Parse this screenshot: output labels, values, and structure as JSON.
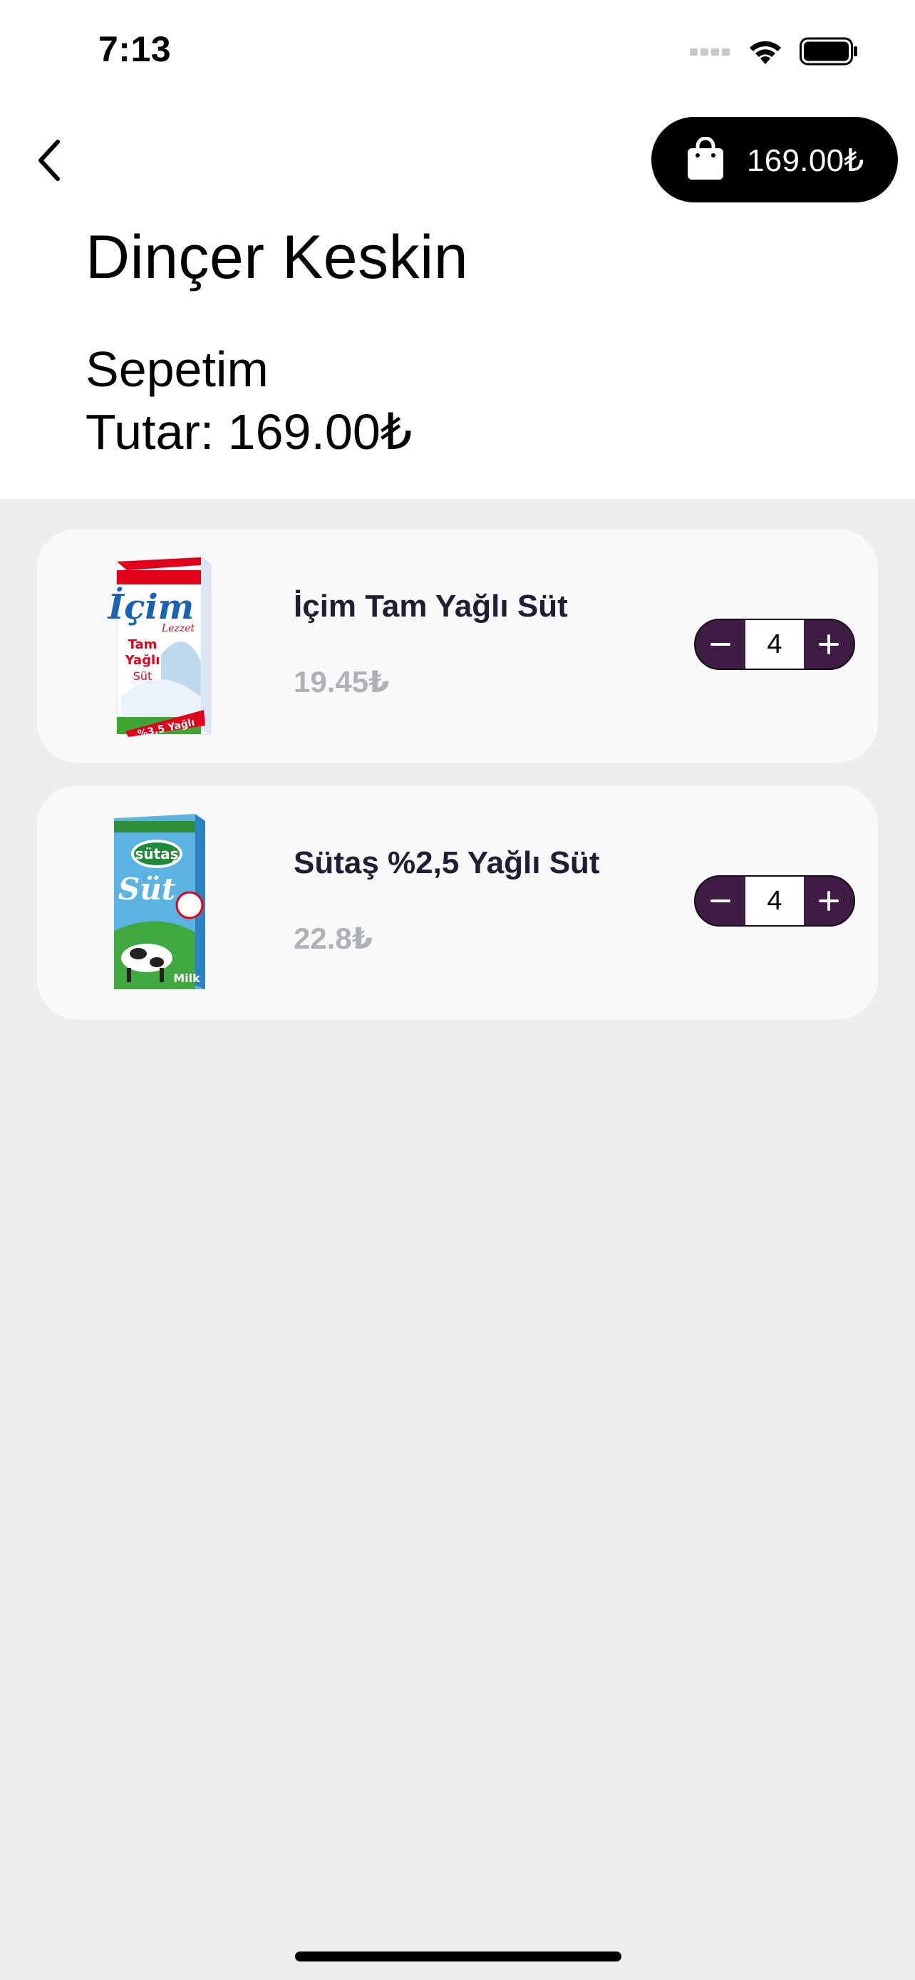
{
  "status_bar": {
    "time": "7:13",
    "icons": [
      "signal-icon",
      "wifi-icon",
      "battery-icon"
    ]
  },
  "header": {
    "back_icon": "chevron-left-icon",
    "cart_total": "169.00₺",
    "cart_icon": "shopping-bag-icon",
    "title": "Dinçer Keskin",
    "section": "Sepetim",
    "total_line": "Tutar: 169.00₺"
  },
  "cart": {
    "items": [
      {
        "name": "İçim Tam Yağlı Süt",
        "price": "19.45₺",
        "quantity": "4",
        "image_icon": "icim-milk-carton-image",
        "carton_labels": [
          "İçim",
          "Lezzet",
          "Tam",
          "Yağlı",
          "Süt",
          "%3,5 Yağlı"
        ]
      },
      {
        "name": "Sütaş %2,5 Yağlı Süt",
        "price": "22.8₺",
        "quantity": "4",
        "image_icon": "sutas-milk-carton-image",
        "carton_labels": [
          "sütaş",
          "Süt",
          "Milk"
        ]
      }
    ]
  },
  "colors": {
    "stepper_bg": "#3e1c44",
    "price_gray": "#aeb1b7",
    "name_color": "#1e1f33",
    "card_bg": "#f9f9f9",
    "page_bg": "#eeeeee"
  }
}
